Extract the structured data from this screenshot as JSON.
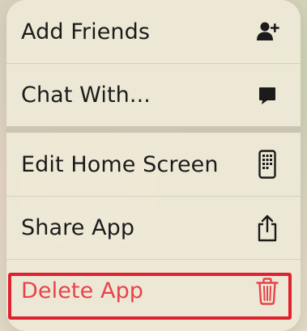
{
  "menu": {
    "items": [
      {
        "label": "Add Friends",
        "icon": "add-friend-icon"
      },
      {
        "label": "Chat With...",
        "icon": "chat-bubble-icon"
      },
      {
        "label": "Edit Home Screen",
        "icon": "phone-apps-icon"
      },
      {
        "label": "Share App",
        "icon": "share-icon"
      },
      {
        "label": "Delete App",
        "icon": "trash-icon",
        "destructive": true
      }
    ]
  },
  "colors": {
    "destructive": "#e8434a",
    "highlight": "#e0212f",
    "text": "#1b1b1b"
  }
}
